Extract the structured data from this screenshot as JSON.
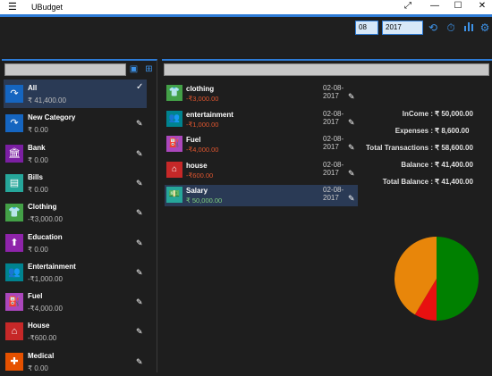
{
  "window": {
    "title": "UBudget",
    "menu_icon": "☰",
    "expand_icon": "⤢",
    "minimize": "—",
    "maximize": "☐",
    "close": "✕"
  },
  "toolbar": {
    "month": "08",
    "year": "2017"
  },
  "categories": [
    {
      "name": "All",
      "amount": "₹ 41,400.00",
      "icon": "circle-arrow-icon",
      "color": "#1565c0",
      "glyph": "↷",
      "selected": true
    },
    {
      "name": "New Category",
      "amount": "₹ 0.00",
      "icon": "circle-arrow-icon",
      "color": "#1565c0",
      "glyph": "↷"
    },
    {
      "name": "Bank",
      "amount": "₹ 0.00",
      "icon": "bank-icon",
      "color": "#7b1fa2",
      "glyph": "🏛"
    },
    {
      "name": "Bills",
      "amount": "₹ 0.00",
      "icon": "bill-icon",
      "color": "#26a69a",
      "glyph": "▤"
    },
    {
      "name": "Clothing",
      "amount": "-₹3,000.00",
      "icon": "shirt-icon",
      "color": "#43a047",
      "glyph": "👕"
    },
    {
      "name": "Education",
      "amount": "₹ 0.00",
      "icon": "education-icon",
      "color": "#8e24aa",
      "glyph": "⬆"
    },
    {
      "name": "Entertainment",
      "amount": "-₹1,000.00",
      "icon": "people-icon",
      "color": "#00838f",
      "glyph": "👥"
    },
    {
      "name": "Fuel",
      "amount": "-₹4,000.00",
      "icon": "fuel-icon",
      "color": "#ab47bc",
      "glyph": "⛽"
    },
    {
      "name": "House",
      "amount": "-₹600.00",
      "icon": "house-icon",
      "color": "#c62828",
      "glyph": "⌂"
    },
    {
      "name": "Medical",
      "amount": "₹ 0.00",
      "icon": "medical-icon",
      "color": "#e65100",
      "glyph": "✚"
    }
  ],
  "transactions": [
    {
      "name": "clothing",
      "amount": "-₹3,000.00",
      "date": "02-08-2017",
      "color": "#43a047",
      "glyph": "👕",
      "icon": "shirt-icon",
      "amt_color": "#e0562f"
    },
    {
      "name": "entertainment",
      "amount": "-₹1,000.00",
      "date": "02-08-2017",
      "color": "#00838f",
      "glyph": "👥",
      "icon": "people-icon",
      "amt_color": "#e0562f"
    },
    {
      "name": "Fuel",
      "amount": "-₹4,000.00",
      "date": "02-08-2017",
      "color": "#ab47bc",
      "glyph": "⛽",
      "icon": "fuel-icon",
      "amt_color": "#e0562f"
    },
    {
      "name": "house",
      "amount": "-₹600.00",
      "date": "02-08-2017",
      "color": "#c62828",
      "glyph": "⌂",
      "icon": "house-icon",
      "amt_color": "#e0562f"
    },
    {
      "name": "Salary",
      "amount": "₹ 50,000.00",
      "date": "02-08-2017",
      "color": "#26a69a",
      "glyph": "💵",
      "icon": "money-icon",
      "amt_color": "#7fd07f",
      "selected": true
    }
  ],
  "summary": [
    {
      "label": "InCome :",
      "value": "₹ 50,000.00"
    },
    {
      "label": "Expenses :",
      "value": "₹ 8,600.00"
    },
    {
      "label": "Total Transactions :",
      "value": "₹ 58,600.00"
    },
    {
      "label": "Balance :",
      "value": "₹ 41,400.00"
    },
    {
      "label": "Total Balance :",
      "value": "₹ 41,400.00"
    }
  ],
  "pie": [
    {
      "label": "Income",
      "value": 50000,
      "color": "#008000"
    },
    {
      "label": "Expenses",
      "value": 8600,
      "color": "#e81010"
    },
    {
      "label": "Balance",
      "value": 41400,
      "color": "#e8860a"
    }
  ]
}
